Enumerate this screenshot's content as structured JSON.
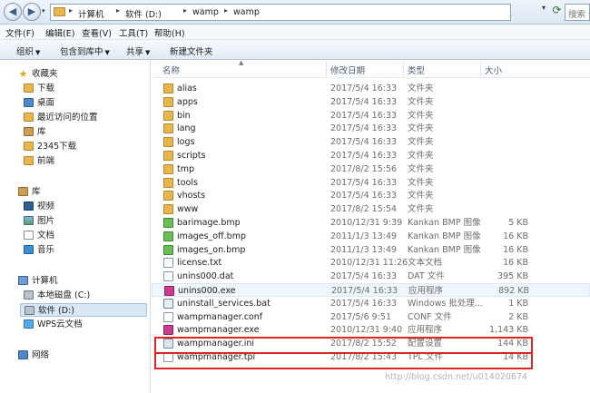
{
  "address": {
    "crumbs": [
      "计算机",
      "软件 (D:)",
      "wamp",
      "wamp"
    ],
    "search_placeholder": "搜索 wamp"
  },
  "menu": [
    "文件(F)",
    "编辑(E)",
    "查看(V)",
    "工具(T)",
    "帮助(H)"
  ],
  "toolbar": {
    "organize": "组织",
    "include": "包含到库中",
    "share": "共享",
    "new_folder": "新建文件夹"
  },
  "nav": {
    "favorites": "收藏夹",
    "fav_items": [
      "下载",
      "桌面",
      "最近访问的位置"
    ],
    "library_short": "库",
    "extra_items": [
      "2345下载",
      "前端"
    ],
    "libraries": "库",
    "lib_items": [
      "视频",
      "图片",
      "文档",
      "音乐"
    ],
    "computer": "计算机",
    "drives": [
      "本地磁盘 (C:)",
      "软件 (D:)",
      "WPS云文档"
    ],
    "network": "网络"
  },
  "columns": {
    "name": "名称",
    "modified": "修改日期",
    "type": "类型",
    "size": "大小"
  },
  "files": [
    {
      "name": "alias",
      "date": "2017/5/4 16:33",
      "type": "文件夹",
      "size": "",
      "icon": "folder"
    },
    {
      "name": "apps",
      "date": "2017/5/4 16:33",
      "type": "文件夹",
      "size": "",
      "icon": "folder"
    },
    {
      "name": "bin",
      "date": "2017/5/4 16:33",
      "type": "文件夹",
      "size": "",
      "icon": "folder"
    },
    {
      "name": "lang",
      "date": "2017/5/4 16:33",
      "type": "文件夹",
      "size": "",
      "icon": "folder"
    },
    {
      "name": "logs",
      "date": "2017/5/4 16:33",
      "type": "文件夹",
      "size": "",
      "icon": "folder"
    },
    {
      "name": "scripts",
      "date": "2017/5/4 16:33",
      "type": "文件夹",
      "size": "",
      "icon": "folder"
    },
    {
      "name": "tmp",
      "date": "2017/8/2 15:56",
      "type": "文件夹",
      "size": "",
      "icon": "folder"
    },
    {
      "name": "tools",
      "date": "2017/5/4 16:33",
      "type": "文件夹",
      "size": "",
      "icon": "folder"
    },
    {
      "name": "vhosts",
      "date": "2017/5/4 16:33",
      "type": "文件夹",
      "size": "",
      "icon": "folder"
    },
    {
      "name": "www",
      "date": "2017/8/2 15:54",
      "type": "文件夹",
      "size": "",
      "icon": "folder"
    },
    {
      "name": "barimage.bmp",
      "date": "2010/12/31 9:39",
      "type": "Kankan BMP 图像",
      "size": "5 KB",
      "icon": "bmp"
    },
    {
      "name": "images_off.bmp",
      "date": "2011/1/3 13:49",
      "type": "Kankan BMP 图像",
      "size": "16 KB",
      "icon": "bmp"
    },
    {
      "name": "images_on.bmp",
      "date": "2011/1/3 13:49",
      "type": "Kankan BMP 图像",
      "size": "16 KB",
      "icon": "bmp"
    },
    {
      "name": "license.txt",
      "date": "2010/12/31 11:26",
      "type": "文本文档",
      "size": "16 KB",
      "icon": "file"
    },
    {
      "name": "unins000.dat",
      "date": "2017/5/4 16:33",
      "type": "DAT 文件",
      "size": "395 KB",
      "icon": "file"
    },
    {
      "name": "unins000.exe",
      "date": "2017/5/4 16:33",
      "type": "应用程序",
      "size": "892 KB",
      "icon": "exe"
    },
    {
      "name": "uninstall_services.bat",
      "date": "2017/5/4 16:33",
      "type": "Windows 批处理...",
      "size": "1 KB",
      "icon": "bat"
    },
    {
      "name": "wampmanager.conf",
      "date": "2017/5/6 9:51",
      "type": "CONF 文件",
      "size": "2 KB",
      "icon": "file"
    },
    {
      "name": "wampmanager.exe",
      "date": "2010/12/31 9:40",
      "type": "应用程序",
      "size": "1,143 KB",
      "icon": "exe"
    },
    {
      "name": "wampmanager.ini",
      "date": "2017/8/2 15:52",
      "type": "配置设置",
      "size": "144 KB",
      "icon": "ini"
    },
    {
      "name": "wampmanager.tpl",
      "date": "2017/8/2 15:43",
      "type": "TPL 文件",
      "size": "14 KB",
      "icon": "file"
    }
  ],
  "highlight_color": "#e02424",
  "watermark": "http://blog.csdn.net/u014020674"
}
